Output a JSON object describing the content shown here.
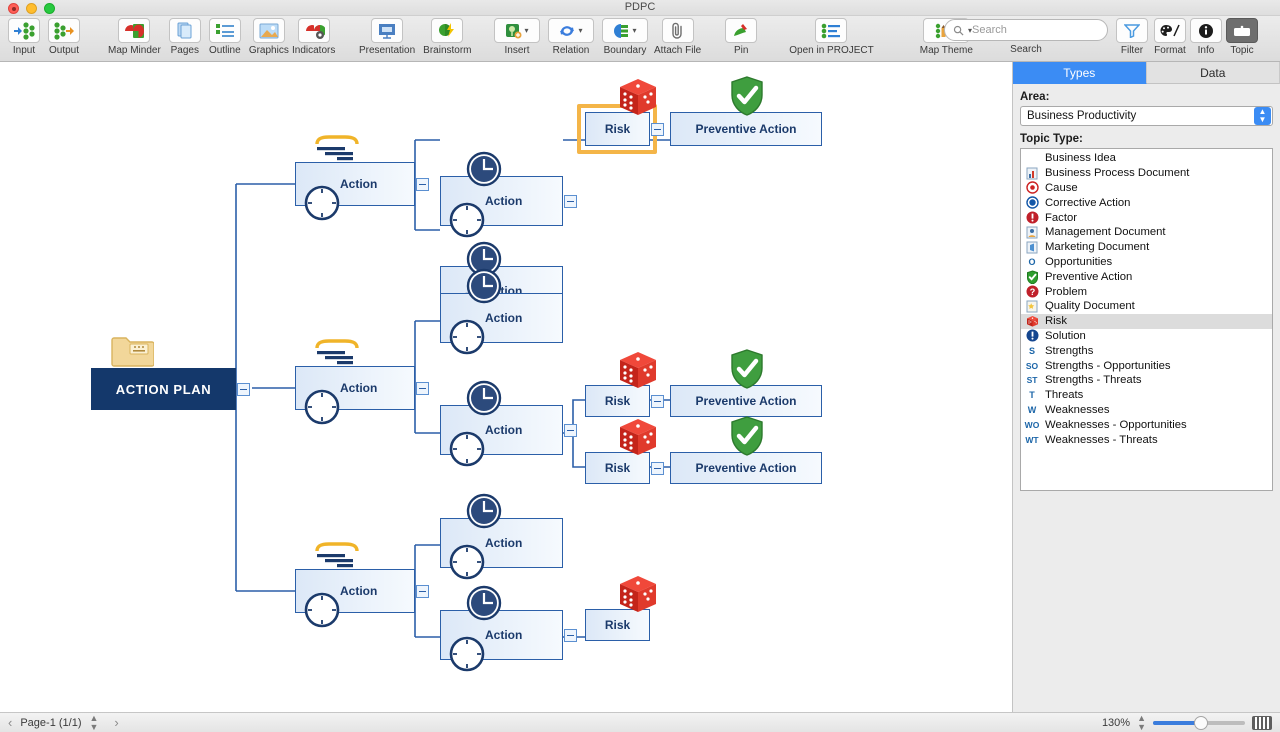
{
  "window": {
    "title": "PDPC"
  },
  "toolbar": {
    "groups": [
      {
        "items": [
          {
            "label": "Input",
            "icon": "input-icon"
          },
          {
            "label": "Output",
            "icon": "output-icon"
          }
        ]
      },
      {
        "items": [
          {
            "label": "Map Minder",
            "icon": "map-minder-icon"
          },
          {
            "label": "Pages",
            "icon": "pages-icon"
          },
          {
            "label": "Outline",
            "icon": "outline-icon"
          },
          {
            "label": "Graphics",
            "icon": "graphics-icon"
          }
        ]
      },
      {
        "items": [
          {
            "label": "Indicators",
            "icon": "indicators-icon"
          }
        ]
      },
      {
        "items": [
          {
            "label": "Presentation",
            "icon": "presentation-icon"
          },
          {
            "label": "Brainstorm",
            "icon": "brainstorm-icon"
          }
        ]
      },
      {
        "items": [
          {
            "label": "Insert",
            "icon": "insert-icon"
          },
          {
            "label": "Relation",
            "icon": "relation-icon"
          },
          {
            "label": "Boundary",
            "icon": "boundary-icon"
          }
        ]
      },
      {
        "items": [
          {
            "label": "Attach File",
            "icon": "paperclip-icon"
          },
          {
            "label": "Pin",
            "icon": "pin-icon"
          },
          {
            "label": "Open in PROJECT",
            "icon": "open-in-project-icon"
          },
          {
            "label": "Map Theme",
            "icon": "map-theme-icon"
          }
        ]
      },
      {
        "items": [
          {
            "label": "Search",
            "icon": "search-icon"
          }
        ]
      },
      {
        "items": [
          {
            "label": "Filter",
            "icon": "filter-icon"
          },
          {
            "label": "Format",
            "icon": "format-icon"
          },
          {
            "label": "Info",
            "icon": "info-icon"
          },
          {
            "label": "Topic",
            "icon": "topic-icon"
          }
        ]
      }
    ],
    "search_placeholder": "Search",
    "search_value": ""
  },
  "panel": {
    "tabs": [
      {
        "label": "Types",
        "active": true
      },
      {
        "label": "Data",
        "active": false
      }
    ],
    "area_label": "Area:",
    "area_value": "Business Productivity",
    "topic_type_label": "Topic Type:",
    "topic_types": [
      {
        "label": "Business Idea",
        "icon": "idea-icon",
        "selected": false
      },
      {
        "label": "Business Process Document",
        "icon": "process-document-icon",
        "selected": false
      },
      {
        "label": "Cause",
        "icon": "cause-icon",
        "selected": false
      },
      {
        "label": "Corrective Action",
        "icon": "corrective-action-icon",
        "selected": false
      },
      {
        "label": "Factor",
        "icon": "factor-icon",
        "selected": false
      },
      {
        "label": "Management Document",
        "icon": "management-document-icon",
        "selected": false
      },
      {
        "label": "Marketing Document",
        "icon": "marketing-document-icon",
        "selected": false
      },
      {
        "label": "Opportunities",
        "icon": "opportunities-icon",
        "selected": false
      },
      {
        "label": "Preventive Action",
        "icon": "preventive-action-icon",
        "selected": false
      },
      {
        "label": "Problem",
        "icon": "problem-icon",
        "selected": false
      },
      {
        "label": "Quality Document",
        "icon": "quality-document-icon",
        "selected": false
      },
      {
        "label": "Risk",
        "icon": "risk-dice-icon",
        "selected": true
      },
      {
        "label": "Solution",
        "icon": "solution-icon",
        "selected": false
      },
      {
        "label": "Strengths",
        "icon": "letter-s-icon",
        "selected": false
      },
      {
        "label": "Strengths - Opportunities",
        "icon": "letter-so-icon",
        "selected": false
      },
      {
        "label": "Strengths - Threats",
        "icon": "letter-st-icon",
        "selected": false
      },
      {
        "label": "Threats",
        "icon": "letter-t-icon",
        "selected": false
      },
      {
        "label": "Weaknesses",
        "icon": "letter-w-icon",
        "selected": false
      },
      {
        "label": "Weaknesses - Opportunities",
        "icon": "letter-wo-icon",
        "selected": false
      },
      {
        "label": "Weaknesses - Threats",
        "icon": "letter-wt-icon",
        "selected": false
      }
    ]
  },
  "statusbar": {
    "prev": "‹",
    "next": "›",
    "page": "Page-1 (1/1)",
    "zoom": "130%"
  },
  "diagram": {
    "root": {
      "label": "ACTION PLAN",
      "icon": "folder-icon"
    },
    "nodes": [
      {
        "id": "a1",
        "label": "Action",
        "type": "action"
      },
      {
        "id": "a1c1",
        "label": "Action",
        "type": "action"
      },
      {
        "id": "a1c2",
        "label": "Action",
        "type": "action"
      },
      {
        "id": "r1",
        "label": "Risk",
        "type": "risk",
        "selected": true
      },
      {
        "id": "p1",
        "label": "Preventive Action",
        "type": "preventive"
      },
      {
        "id": "a2",
        "label": "Action",
        "type": "action"
      },
      {
        "id": "a2c1",
        "label": "Action",
        "type": "action"
      },
      {
        "id": "a2c2",
        "label": "Action",
        "type": "action"
      },
      {
        "id": "r2",
        "label": "Risk",
        "type": "risk"
      },
      {
        "id": "p2",
        "label": "Preventive Action",
        "type": "preventive"
      },
      {
        "id": "r3",
        "label": "Risk",
        "type": "risk"
      },
      {
        "id": "p3",
        "label": "Preventive Action",
        "type": "preventive"
      },
      {
        "id": "a3",
        "label": "Action",
        "type": "action"
      },
      {
        "id": "a3c1",
        "label": "Action",
        "type": "action"
      },
      {
        "id": "a3c2",
        "label": "Action",
        "type": "action"
      },
      {
        "id": "r4",
        "label": "Risk",
        "type": "risk"
      }
    ]
  },
  "colors": {
    "root_fill": "#14386b",
    "node_border": "#2b5fa8",
    "node_text": "#1b3a6b",
    "selection": "#f4b548",
    "accent_blue": "#3b8cf4",
    "risk_red": "#d42a1e",
    "preventive_green": "#3f9e3f"
  }
}
